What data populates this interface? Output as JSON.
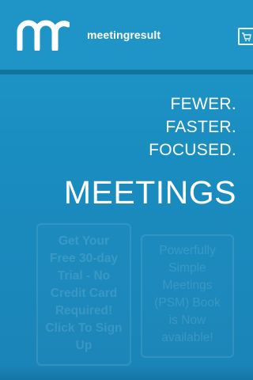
{
  "header": {
    "brand": "meetingresult",
    "logo_icon": "mr-logo",
    "cart_icon": "shopping-cart-icon"
  },
  "hero": {
    "tagline": [
      "FEWER.",
      "FASTER.",
      "FOCUSED."
    ],
    "headline": "MEETINGS"
  },
  "promos": [
    {
      "text": "Get Your Free 30-day Trial - No Credit Card Required! Click To Sign Up"
    },
    {
      "text": "Powerfully Simple Meetings (PSM) Book is Now available!"
    }
  ],
  "colors": {
    "background": "#1a8cbf",
    "header": "#1e95c6",
    "divider": "#12739d",
    "text": "#ffffff"
  }
}
